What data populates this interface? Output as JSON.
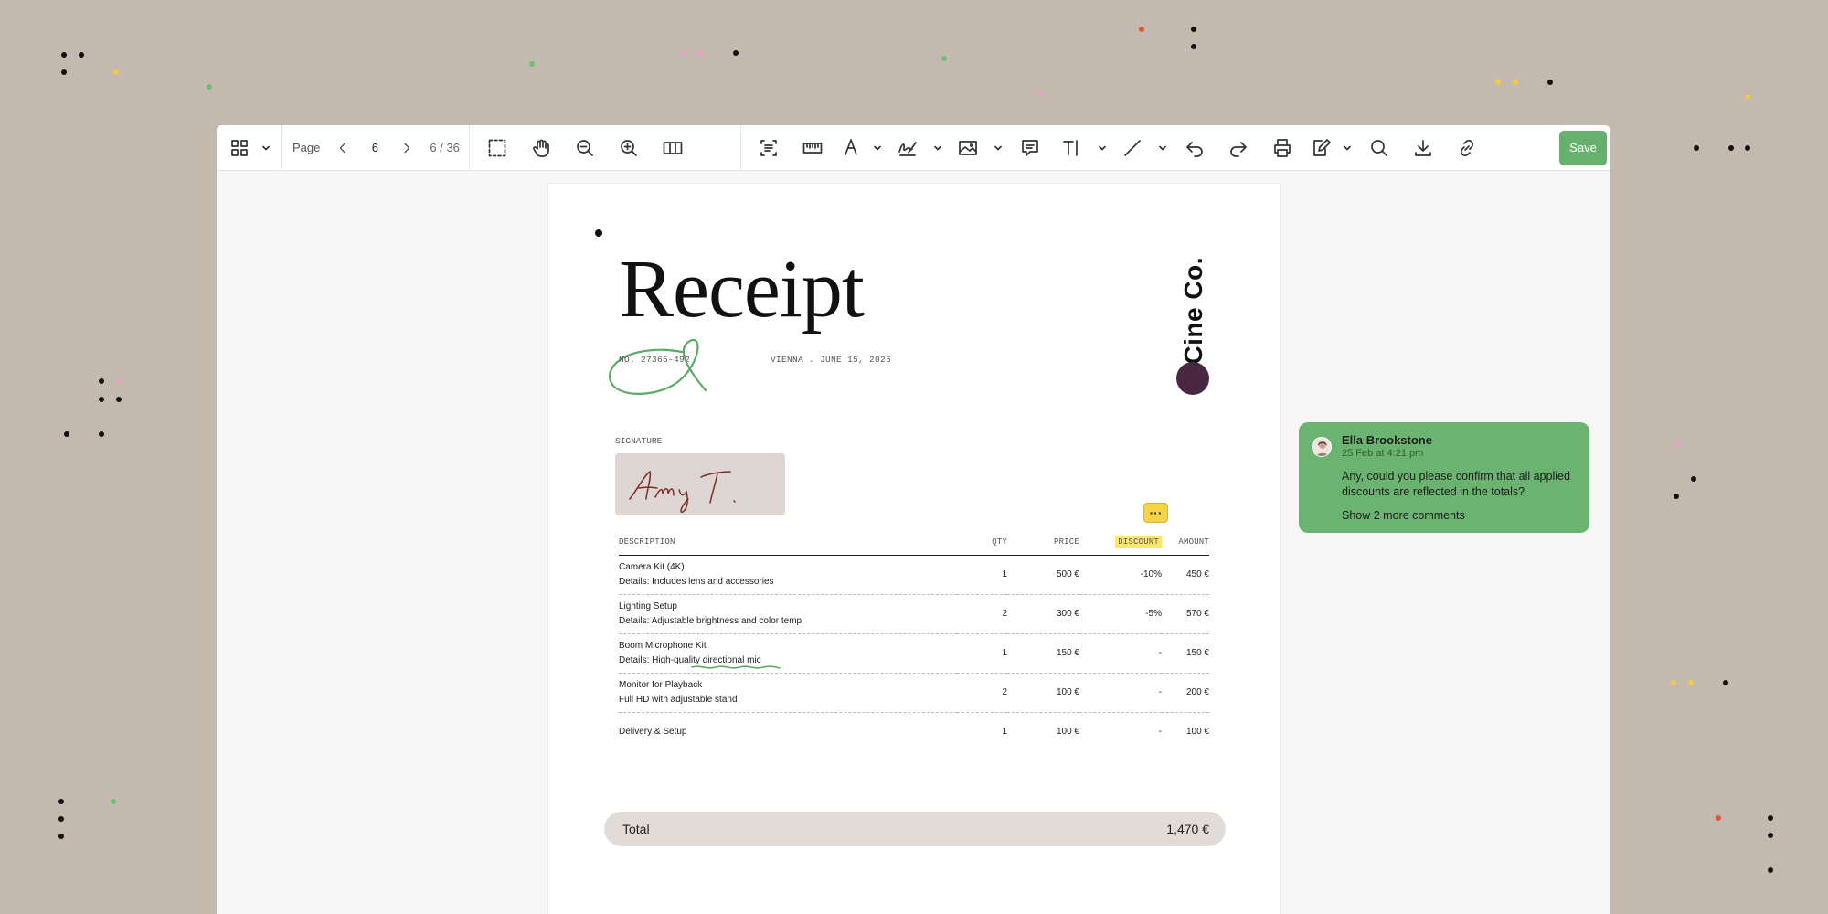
{
  "toolbar": {
    "page_label": "Page",
    "page_value": "6",
    "page_count": "6 / 36",
    "save_label": "Save"
  },
  "document": {
    "title": "Receipt",
    "number": "NO. 27365-492",
    "location_date": "VIENNA . JUNE 15, 2025",
    "brand": "Cine Co.",
    "signature_label": "SIGNATURE",
    "signature_text": "Amy T.",
    "table": {
      "headers": {
        "description": "DESCRIPTION",
        "qty": "QTY",
        "price": "PRICE",
        "discount": "DISCOUNT",
        "amount": "AMOUNT"
      },
      "rows": [
        {
          "name": "Camera Kit (4K)",
          "details": "Details: Includes lens and accessories",
          "qty": "1",
          "price": "500 €",
          "discount": "-10%",
          "amount": "450 €"
        },
        {
          "name": "Lighting Setup",
          "details": "Details: Adjustable brightness and color temp",
          "qty": "2",
          "price": "300 €",
          "discount": "-5%",
          "amount": "570 €"
        },
        {
          "name": "Boom Microphone Kit",
          "details": "Details: High-quality directional mic",
          "qty": "1",
          "price": "150 €",
          "discount": "-",
          "amount": "150 €"
        },
        {
          "name": "Monitor for Playback",
          "details": "Full HD with adjustable stand",
          "qty": "2",
          "price": "100 €",
          "discount": "-",
          "amount": "200 €"
        },
        {
          "name": "Delivery & Setup",
          "details": "",
          "qty": "1",
          "price": "100 €",
          "discount": "-",
          "amount": "100 €"
        }
      ]
    },
    "total_label": "Total",
    "total_value": "1,470 €"
  },
  "comment": {
    "marker": "···",
    "author": "Ella Brookstone",
    "time": "25 Feb at 4:21 pm",
    "text": "Any, could you please confirm that all applied discounts are reflected in the totals?",
    "more": "Show 2 more comments"
  },
  "colors": {
    "background": "#c3b9ae",
    "save": "#66b16e",
    "comment_card": "#6bb370",
    "highlight": "#fbe86a",
    "brand_dot": "#4a2740"
  }
}
